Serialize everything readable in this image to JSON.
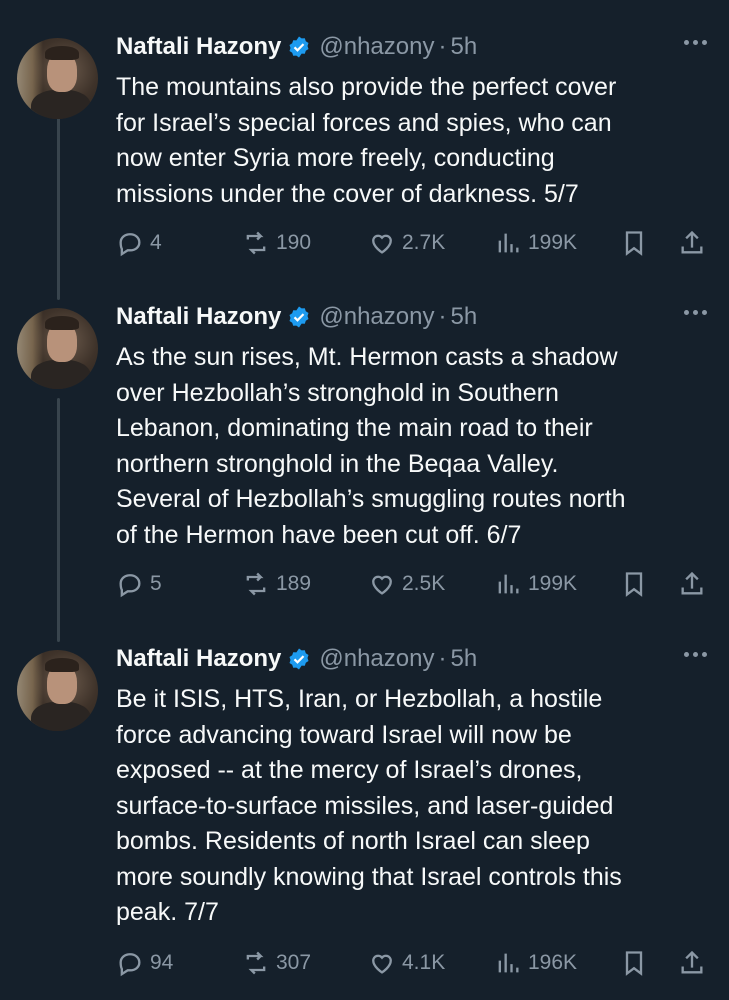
{
  "tweets": [
    {
      "name": "Naftali Hazony",
      "handle": "@nhazony",
      "separator": "·",
      "time": "5h",
      "text": "The mountains also provide the perfect cover\nfor Israel’s special forces and spies, who can\nnow enter Syria more freely, conducting\nmissions under the cover of darkness. 5/7",
      "replies": "4",
      "reposts": "190",
      "likes": "2.7K",
      "views": "199K"
    },
    {
      "name": "Naftali Hazony",
      "handle": "@nhazony",
      "separator": "·",
      "time": "5h",
      "text": "As the sun rises, Mt. Hermon casts a shadow\nover Hezbollah’s stronghold in Southern\nLebanon, dominating the main road to their\nnorthern stronghold in the Beqaa Valley.\nSeveral of Hezbollah’s smuggling routes north\nof the Hermon have been cut off. 6/7",
      "replies": "5",
      "reposts": "189",
      "likes": "2.5K",
      "views": "199K"
    },
    {
      "name": "Naftali Hazony",
      "handle": "@nhazony",
      "separator": "·",
      "time": "5h",
      "text": "Be it ISIS, HTS, Iran, or Hezbollah, a hostile\nforce advancing toward Israel will now be\nexposed -- at the mercy of Israel’s drones,\nsurface-to-surface missiles, and laser-guided\nbombs. Residents of north Israel can sleep\nmore soundly knowing that Israel controls this\npeak. 7/7",
      "replies": "94",
      "reposts": "307",
      "likes": "4.1K",
      "views": "196K"
    }
  ],
  "colors": {
    "background": "#15202b",
    "text": "#f7f9f9",
    "muted": "#8b98a5",
    "verified": "#1d9bf0",
    "thread_line": "#38444d"
  },
  "icons": [
    "verified-badge-icon",
    "more-icon",
    "reply-icon",
    "repost-icon",
    "like-icon",
    "views-icon",
    "bookmark-icon",
    "share-icon"
  ]
}
